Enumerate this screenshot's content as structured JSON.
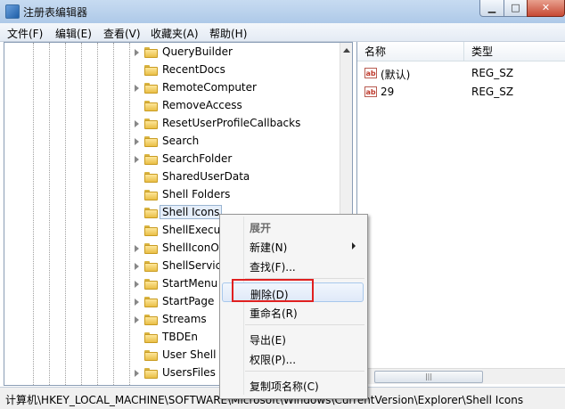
{
  "window": {
    "title": "注册表编辑器",
    "minimize_glyph": "▁",
    "maximize_glyph": "□",
    "close_glyph": "✕"
  },
  "menu": [
    "文件(F)",
    "编辑(E)",
    "查看(V)",
    "收藏夹(A)",
    "帮助(H)"
  ],
  "tree": {
    "items": [
      {
        "label": "QueryBuilder",
        "expandable": true
      },
      {
        "label": "RecentDocs",
        "expandable": false
      },
      {
        "label": "RemoteComputer",
        "expandable": true
      },
      {
        "label": "RemoveAccess",
        "expandable": false
      },
      {
        "label": "ResetUserProfileCallbacks",
        "expandable": true
      },
      {
        "label": "Search",
        "expandable": true
      },
      {
        "label": "SearchFolder",
        "expandable": true
      },
      {
        "label": "SharedUserData",
        "expandable": false
      },
      {
        "label": "Shell Folders",
        "expandable": false
      },
      {
        "label": "Shell Icons",
        "expandable": false,
        "selected": true
      },
      {
        "label": "ShellExecut",
        "expandable": false
      },
      {
        "label": "ShellIconOv",
        "expandable": true
      },
      {
        "label": "ShellService",
        "expandable": true
      },
      {
        "label": "StartMenu",
        "expandable": true
      },
      {
        "label": "StartPage",
        "expandable": true
      },
      {
        "label": "Streams",
        "expandable": true
      },
      {
        "label": "TBDEn",
        "expandable": false
      },
      {
        "label": "User Shell",
        "expandable": false
      },
      {
        "label": "UsersFiles",
        "expandable": true
      }
    ]
  },
  "values": {
    "columns": {
      "name": "名称",
      "type": "类型"
    },
    "rows": [
      {
        "icon": "ab",
        "name": "(默认)",
        "type": "REG_SZ"
      },
      {
        "icon": "ab",
        "name": "29",
        "type": "REG_SZ"
      }
    ],
    "hscroll_grip": "|||"
  },
  "context_menu": {
    "items": [
      {
        "label": "展开",
        "disabled": true
      },
      {
        "label": "新建(N)",
        "submenu": true
      },
      {
        "label": "查找(F)..."
      },
      {
        "label": "删除(D)",
        "hover": true
      },
      {
        "label": "重命名(R)"
      },
      {
        "label": "导出(E)"
      },
      {
        "label": "权限(P)..."
      },
      {
        "label": "复制项名称(C)"
      }
    ]
  },
  "status_bar": {
    "path": "计算机\\HKEY_LOCAL_MACHINE\\SOFTWARE\\Microsoft\\Windows\\CurrentVersion\\Explorer\\Shell Icons"
  },
  "colors": {
    "titlebar": "#aec9e8",
    "selection_outline": "#99b4d1",
    "highlight_box": "#e02020"
  }
}
